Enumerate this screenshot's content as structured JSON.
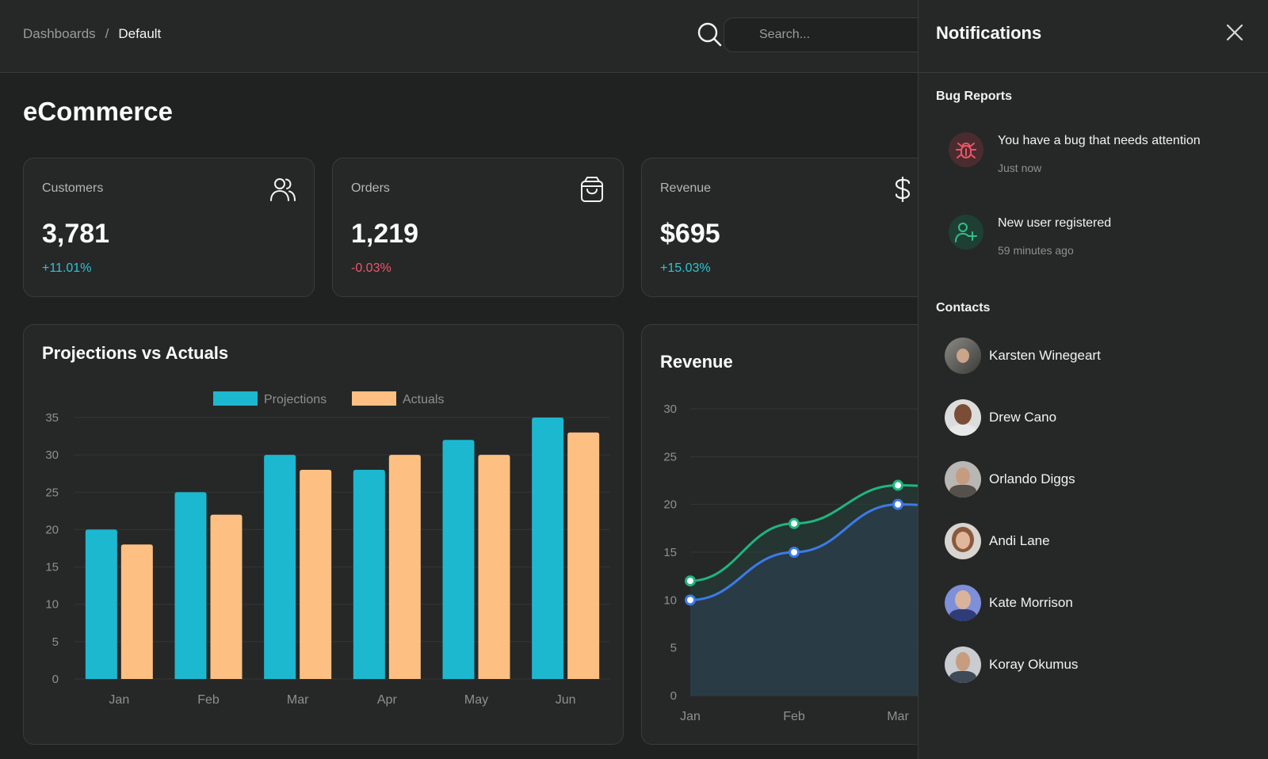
{
  "breadcrumb": {
    "root": "Dashboards",
    "separator": "/",
    "current": "Default"
  },
  "search": {
    "placeholder": "Search..."
  },
  "page_title": "eCommerce",
  "stats": [
    {
      "label": "Customers",
      "value": "3,781",
      "change": "+11.01%",
      "trend": "up",
      "icon": "users-icon"
    },
    {
      "label": "Orders",
      "value": "1,219",
      "change": "-0.03%",
      "trend": "down",
      "icon": "shopping-bag-icon"
    },
    {
      "label": "Revenue",
      "value": "$695",
      "change": "+15.03%",
      "trend": "up",
      "icon": "dollar-icon"
    }
  ],
  "colors": {
    "positive": "#2ec4d6",
    "negative": "#f0556a",
    "projections": "#1cb8cf",
    "actuals": "#fec082",
    "line_green": "#1fb57e",
    "line_blue": "#3d7ae8",
    "bug": "#ec5566",
    "user_add": "#2fc08a"
  },
  "chart_data": [
    {
      "type": "bar",
      "title": "Projections vs Actuals",
      "categories": [
        "Jan",
        "Feb",
        "Mar",
        "Apr",
        "May",
        "Jun"
      ],
      "series": [
        {
          "name": "Projections",
          "values": [
            20,
            25,
            30,
            28,
            32,
            35
          ]
        },
        {
          "name": "Actuals",
          "values": [
            18,
            22,
            28,
            30,
            30,
            33
          ]
        }
      ],
      "yticks": [
        "0",
        "5",
        "10",
        "15",
        "20",
        "25",
        "30",
        "35"
      ],
      "ylim": [
        0,
        35
      ],
      "legend": "top-center",
      "grid": true
    },
    {
      "type": "area",
      "title": "Revenue",
      "categories": [
        "Jan",
        "Feb",
        "Mar"
      ],
      "series": [
        {
          "values": [
            12,
            18,
            22
          ]
        },
        {
          "values": [
            10,
            15,
            20
          ]
        }
      ],
      "yticks": [
        "0",
        "5",
        "10",
        "15",
        "20",
        "25",
        "30"
      ],
      "ylim": [
        0,
        30
      ],
      "grid": true
    }
  ],
  "notifications": {
    "title": "Notifications",
    "bug_section": "Bug Reports",
    "items": [
      {
        "title": "You have a bug that needs attention",
        "time": "Just now",
        "icon": "bug-icon"
      },
      {
        "title": "New user registered",
        "time": "59 minutes ago",
        "icon": "user-plus-icon"
      }
    ],
    "contacts_section": "Contacts",
    "contacts": [
      {
        "name": "Karsten Winegeart"
      },
      {
        "name": "Drew Cano"
      },
      {
        "name": "Orlando Diggs"
      },
      {
        "name": "Andi Lane"
      },
      {
        "name": "Kate Morrison"
      },
      {
        "name": "Koray Okumus"
      }
    ]
  }
}
